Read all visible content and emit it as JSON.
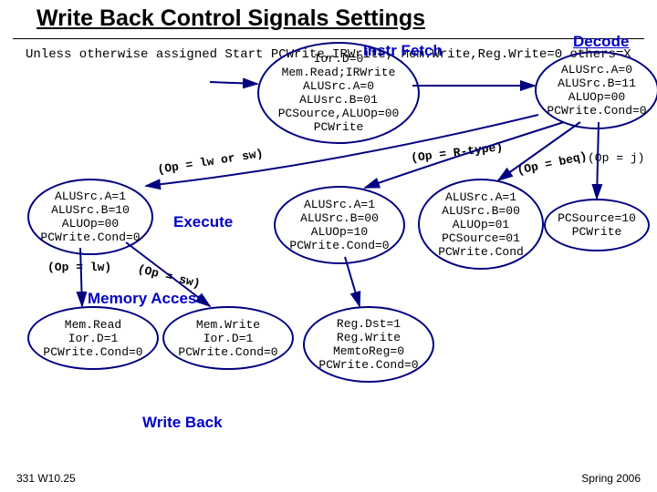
{
  "title": "Write Back Control Signals Settings",
  "note": "Unless otherwise assigned\n                 Start\n PCWrite,IRWrite,\n Mem.Write,Reg.Write=0\n others=X",
  "stage_labels": {
    "fetch": "Instr Fetch",
    "decode": "Decode",
    "execute": "Execute",
    "memacc": "Memory Access",
    "wb": "Write Back"
  },
  "states": {
    "fetch": "Ior.D=0\nMem.Read;IRWrite\nALUSrc.A=0\nALUsrc.B=01\nPCSource,ALUOp=00\nPCWrite",
    "decode": "ALUSrc.A=0\nALUSrc.B=11\nALUOp=00\nPCWrite.Cond=0",
    "ex_mem": "ALUSrc.A=1\nALUSrc.B=10\nALUOp=00\nPCWrite.Cond=0",
    "ex_r": "ALUSrc.A=1\nALUSrc.B=00\nALUOp=10\nPCWrite.Cond=0",
    "ex_beq": "ALUSrc.A=1\nALUSrc.B=00\nALUOp=01\nPCSource=01\nPCWrite.Cond",
    "ex_j": "PCSource=10\nPCWrite",
    "mem_rd": "Mem.Read\nIor.D=1\nPCWrite.Cond=0",
    "mem_wr": "Mem.Write\nIor.D=1\nPCWrite.Cond=0",
    "wb_r": "Reg.Dst=1\nReg.Write\nMemtoReg=0\nPCWrite.Cond=0"
  },
  "edges": {
    "lw_sw": "(Op = lw or sw)",
    "rtype": "(Op = R-type)",
    "beq": "(Op = beq)",
    "j": "(Op = j)",
    "lw": "(Op = lw)",
    "sw": "(Op = sw)"
  },
  "footer": {
    "left": "331 W10.25",
    "right": "Spring 2006"
  }
}
